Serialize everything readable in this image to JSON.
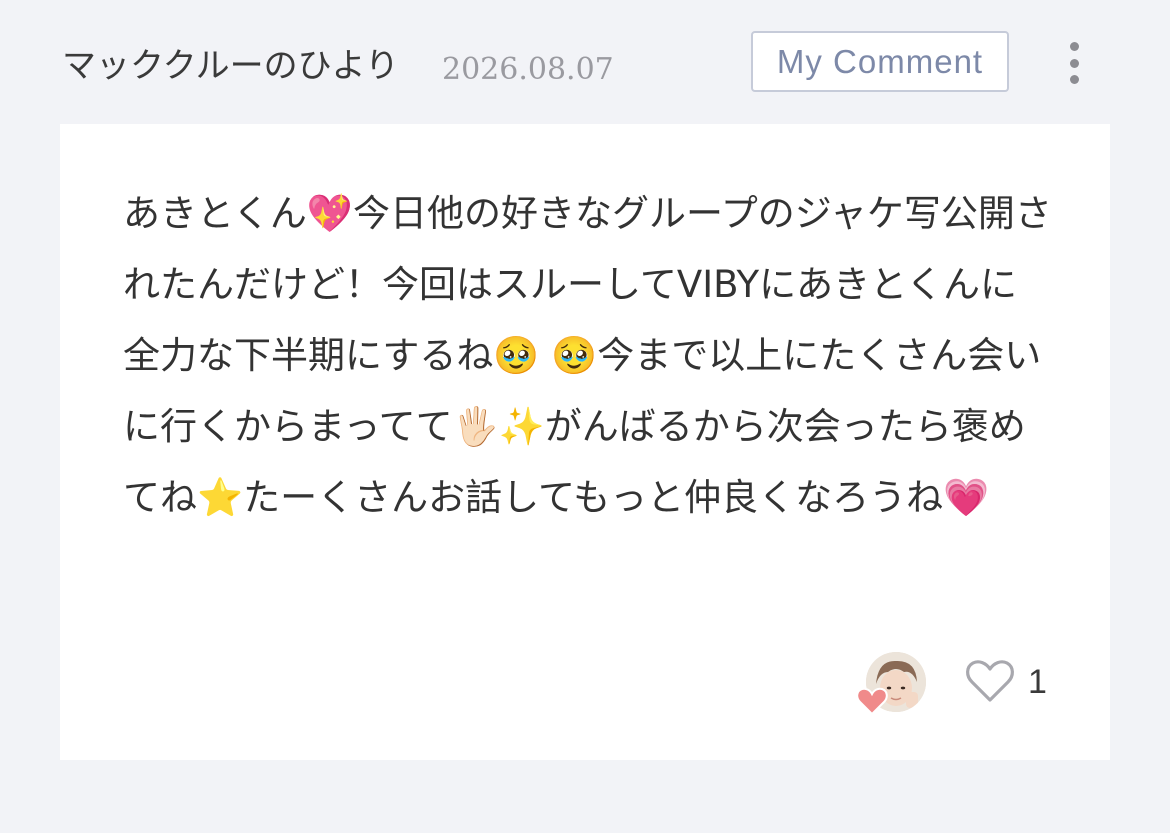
{
  "post": {
    "username": "マッククルーのひより",
    "date": "2026.08.07",
    "badge_label": "My Comment",
    "more_icon": "more-vertical-icon",
    "comment_text": "あきとくん💖今日他の好きなグループのジャケ写公開されたんだけど！今回はスルーしてVIBYにあきとくんに全力な下半期にするね🥹 🥹今まで以上にたくさん会いに行くからまってて🖐🏻✨がんばるから次会ったら褒めてね⭐️たーくさんお話してもっと仲良くなろうね💗"
  },
  "reactions": {
    "avatar_icon": "user-avatar",
    "avatar_badge_icon": "heart-icon",
    "avatar_badge_color": "#f08a8a",
    "like_icon": "heart-outline-icon",
    "like_count": "1"
  },
  "colors": {
    "page_background": "#f2f3f7",
    "card_background": "#ffffff",
    "badge_text": "#7d89a8",
    "badge_border": "#c6cbd9",
    "date_text": "#9a9aa0"
  }
}
